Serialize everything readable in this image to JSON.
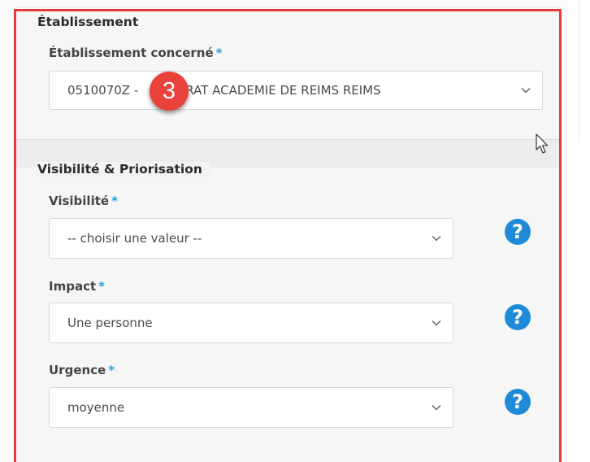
{
  "sections": {
    "etablissement": {
      "legend": "Établissement",
      "field": {
        "label": "Établissement concerné",
        "required_marker": "*",
        "value_prefix": "0510070Z -",
        "value_suffix": "RAT ACADEMIE DE REIMS REIMS"
      }
    },
    "visibilite": {
      "legend": "Visibilité & Priorisation",
      "fields": [
        {
          "label": "Visibilité",
          "required_marker": "*",
          "value": "-- choisir une valeur --",
          "help": "?"
        },
        {
          "label": "Impact",
          "required_marker": "*",
          "value": "Une personne",
          "help": "?"
        },
        {
          "label": "Urgence",
          "required_marker": "*",
          "value": "moyenne",
          "help": "?"
        }
      ]
    }
  },
  "annotation": {
    "step_number": "3"
  },
  "colors": {
    "required": "#2a9fd6",
    "help_icon": "#1f8ad8",
    "badge": "#e9423b",
    "highlight_border": "#e23b3b"
  },
  "icons": {
    "dropdown": "chevron-down-icon",
    "help": "question-circle-icon",
    "cursor": "mouse-pointer-icon"
  }
}
